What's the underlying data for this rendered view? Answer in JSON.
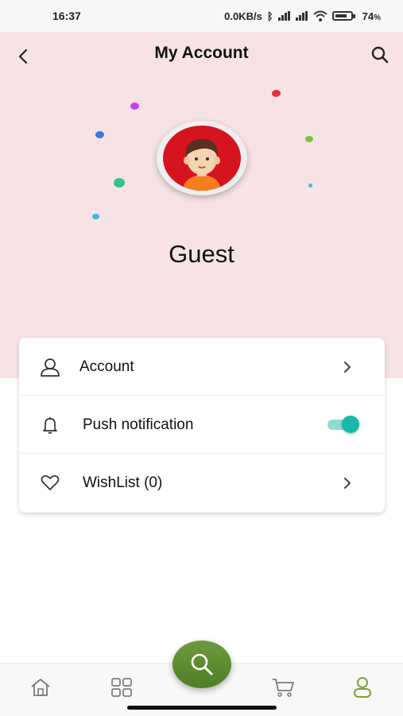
{
  "status_bar": {
    "time": "16:37",
    "network_speed": "0.0KB/s",
    "battery_percent": "74",
    "battery_suffix": "%"
  },
  "header": {
    "title": "My Account",
    "back_icon": "chevron-left-icon",
    "search_icon": "search-icon"
  },
  "profile": {
    "name": "Guest",
    "avatar_icon": "user-avatar"
  },
  "menu": {
    "items": [
      {
        "label": "Account",
        "icon": "user-outline-icon",
        "action": "chevron-right-icon"
      },
      {
        "label": "Push notification",
        "icon": "bell-icon",
        "toggle_on": true
      },
      {
        "label": "WishList (0)",
        "icon": "heart-outline-icon",
        "action": "chevron-right-icon"
      }
    ]
  },
  "bottom_nav": {
    "items": [
      "home-icon",
      "grid-icon",
      "search-icon",
      "cart-icon",
      "user-icon"
    ],
    "active": "user-icon"
  },
  "colors": {
    "header_bg": "#f7e3e6",
    "toggle_accent": "#17b8a6",
    "fab_green": "#5e8c30",
    "active_nav": "#7aa23a",
    "avatar_bg": "#d6141f"
  }
}
